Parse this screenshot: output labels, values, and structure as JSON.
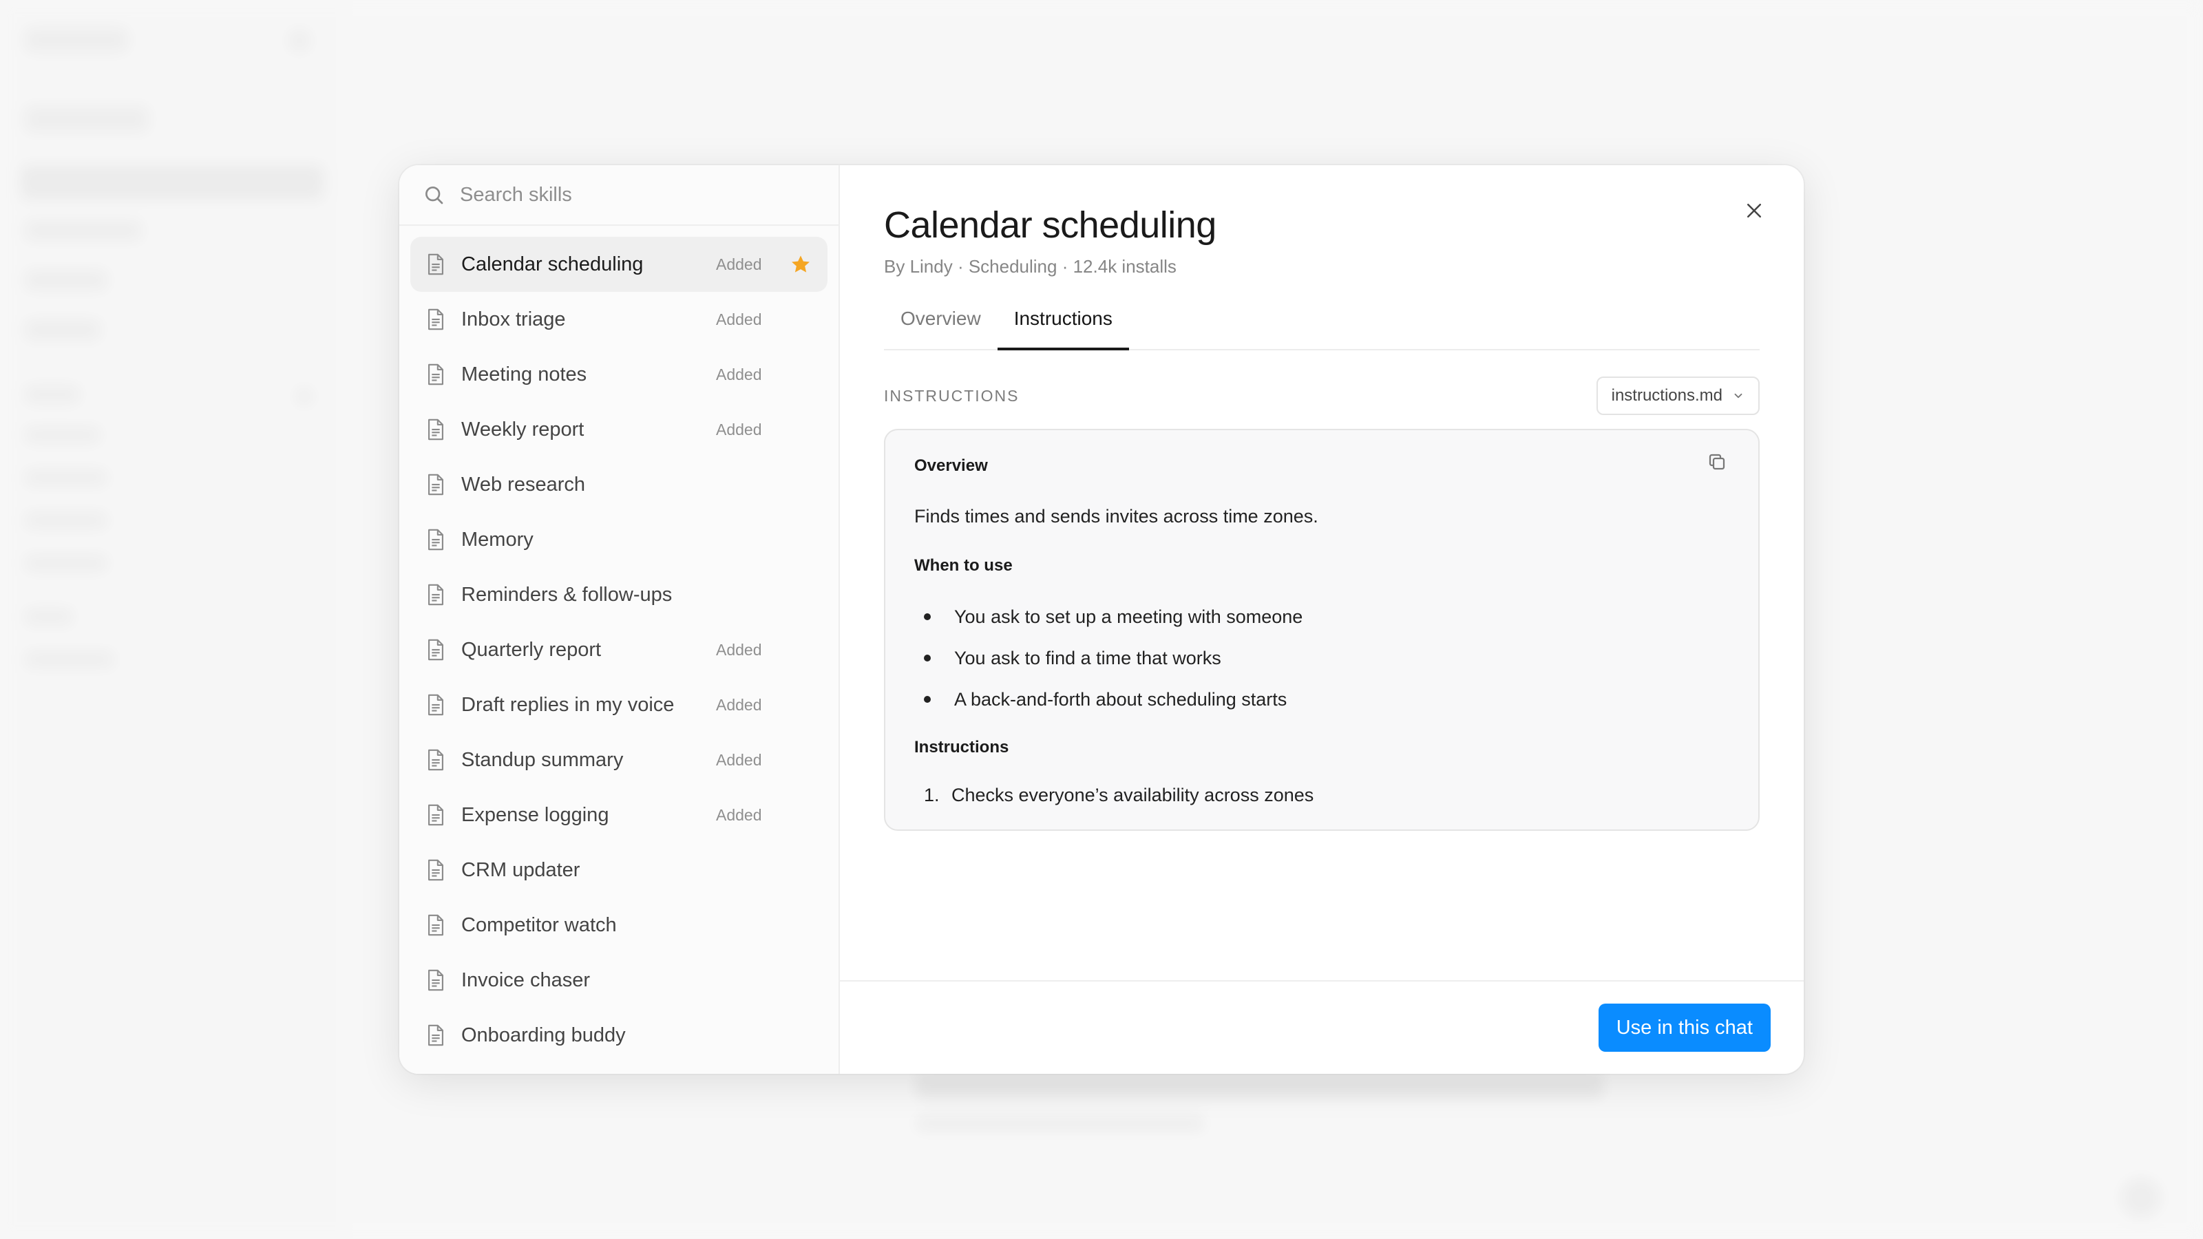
{
  "search": {
    "placeholder": "Search skills"
  },
  "skills": [
    {
      "name": "Calendar scheduling",
      "status": "Added",
      "starred": true,
      "selected": true
    },
    {
      "name": "Inbox triage",
      "status": "Added"
    },
    {
      "name": "Meeting notes",
      "status": "Added"
    },
    {
      "name": "Weekly report",
      "status": "Added"
    },
    {
      "name": "Web research",
      "status": ""
    },
    {
      "name": "Memory",
      "status": ""
    },
    {
      "name": "Reminders & follow-ups",
      "status": ""
    },
    {
      "name": "Quarterly report",
      "status": "Added"
    },
    {
      "name": "Draft replies in my voice",
      "status": "Added"
    },
    {
      "name": "Standup summary",
      "status": "Added"
    },
    {
      "name": "Expense logging",
      "status": "Added"
    },
    {
      "name": "CRM updater",
      "status": ""
    },
    {
      "name": "Competitor watch",
      "status": ""
    },
    {
      "name": "Invoice chaser",
      "status": ""
    },
    {
      "name": "Onboarding buddy",
      "status": ""
    }
  ],
  "detail": {
    "title": "Calendar scheduling",
    "meta": "By Lindy · Scheduling · 12.4k installs",
    "tabs": [
      "Overview",
      "Instructions"
    ],
    "active_tab": "Instructions",
    "section_label": "INSTRUCTIONS",
    "file_select": "instructions.md",
    "content": {
      "overview_heading": "Overview",
      "overview_text": "Finds times and sends invites across time zones.",
      "when_heading": "When to use",
      "when_items": [
        "You ask to set up a meeting with someone",
        "You ask to find a time that works",
        "A back-and-forth about scheduling starts"
      ],
      "instructions_heading": "Instructions",
      "instructions_items": [
        "Checks everyone’s availability across zones"
      ]
    }
  },
  "footer": {
    "primary_label": "Use in this chat"
  },
  "colors": {
    "accent": "#0a8cff",
    "star": "#f5a623"
  }
}
